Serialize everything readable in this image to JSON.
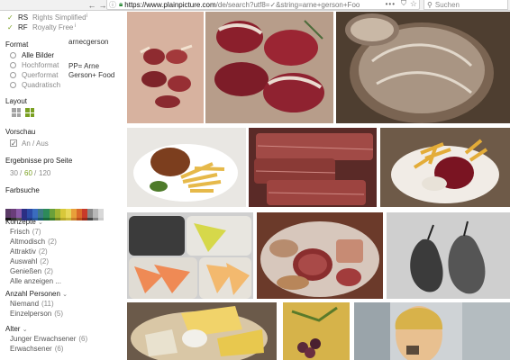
{
  "browser": {
    "url_host": "https://www.plainpicture.com",
    "url_path": "/de/search?utf8=✓&string=arne+gerson+Foo",
    "url_more": "•••",
    "search_placeholder": "Suchen"
  },
  "license": {
    "rs_code": "RS",
    "rs_label": "Rights Simplified",
    "rf_code": "RF",
    "rf_label": "Royalty Free",
    "info_mark": "i"
  },
  "author": {
    "name": "arnecgerson",
    "tag": "PP= Arne Gerson+ Food"
  },
  "format": {
    "heading": "Format",
    "options": [
      "Alle Bilder",
      "Hochformat",
      "Querformat",
      "Quadratisch"
    ]
  },
  "layout": {
    "heading": "Layout"
  },
  "preview": {
    "heading": "Vorschau",
    "toggle_label": "An / Aus"
  },
  "per_page": {
    "heading": "Ergebnisse pro Seite",
    "opt_30": "30",
    "opt_60": "60",
    "opt_120": "120",
    "sep": "/",
    "active_color": "#7aa022"
  },
  "color_search": {
    "heading": "Farbsuche",
    "swatches": [
      "#5a3a66",
      "#6a3d7a",
      "#8a5aa8",
      "#2b2f84",
      "#2c4aa6",
      "#3a6cbe",
      "#3d7a84",
      "#2d8a5a",
      "#6aa03a",
      "#a0b432",
      "#d8c83a",
      "#e8d85a",
      "#e8a03a",
      "#d96a2a",
      "#c83a2a",
      "#8a8a8a",
      "#b8b8b8",
      "#d8d8d8"
    ],
    "swatches_lower": [
      "#111111",
      "#333333",
      "#555555",
      "#2b2f84",
      "#1f3f8a",
      "#2a5aa0",
      "#1a5a6a",
      "#1a6a3a",
      "#3a7a2a",
      "#7a8a22",
      "#b8a82a",
      "#c8b83a",
      "#c8802a",
      "#b8501a",
      "#982a1a",
      "#444444",
      "#888888",
      "#cccccc"
    ]
  },
  "concepts": {
    "heading": "Konzepte",
    "items": [
      {
        "label": "Frisch",
        "count": "(7)"
      },
      {
        "label": "Altmodisch",
        "count": "(2)"
      },
      {
        "label": "Attraktiv",
        "count": "(2)"
      },
      {
        "label": "Auswahl",
        "count": "(2)"
      },
      {
        "label": "Genießen",
        "count": "(2)"
      }
    ],
    "show_all": "Alle anzeigen ..."
  },
  "persons": {
    "heading": "Anzahl Personen",
    "items": [
      {
        "label": "Niemand",
        "count": "(11)"
      },
      {
        "label": "Einzelperson",
        "count": "(5)"
      }
    ]
  },
  "age": {
    "heading": "Alter",
    "items": [
      {
        "label": "Junger Erwachsener",
        "count": "(6)"
      },
      {
        "label": "Erwachsener",
        "count": "(6)"
      }
    ]
  }
}
